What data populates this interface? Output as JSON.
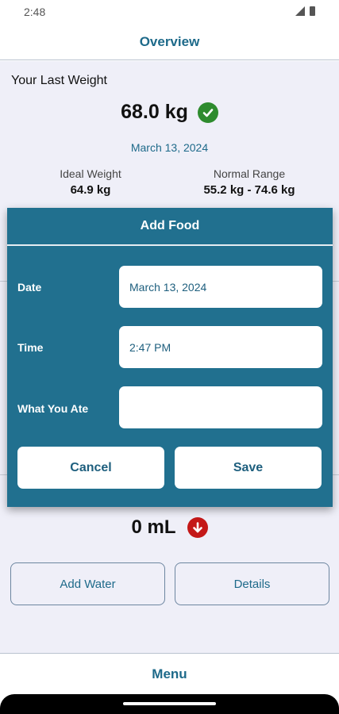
{
  "status_bar": {
    "time": "2:48"
  },
  "header": {
    "title": "Overview"
  },
  "last_weight": {
    "title": "Your Last Weight",
    "value": "68.0 kg",
    "date": "March 13, 2024",
    "ideal_label": "Ideal Weight",
    "ideal_value": "64.9 kg",
    "normal_label": "Normal Range",
    "normal_value": "55.2 kg - 74.6 kg"
  },
  "water": {
    "value": "0 mL",
    "add_label": "Add Water",
    "details_label": "Details"
  },
  "dialog": {
    "title": "Add Food",
    "date_label": "Date",
    "date_value": "March 13, 2024",
    "time_label": "Time",
    "time_value": "2:47 PM",
    "food_label": "What You Ate",
    "food_value": "",
    "cancel_label": "Cancel",
    "save_label": "Save"
  },
  "footer": {
    "menu_label": "Menu"
  },
  "colors": {
    "accent": "#21708f",
    "link": "#1e6a8a",
    "ok": "#2e8b2e",
    "alert": "#c41818"
  },
  "icons": [
    "signal-icon",
    "battery-icon",
    "check-circle-icon",
    "arrow-down-circle-icon"
  ]
}
